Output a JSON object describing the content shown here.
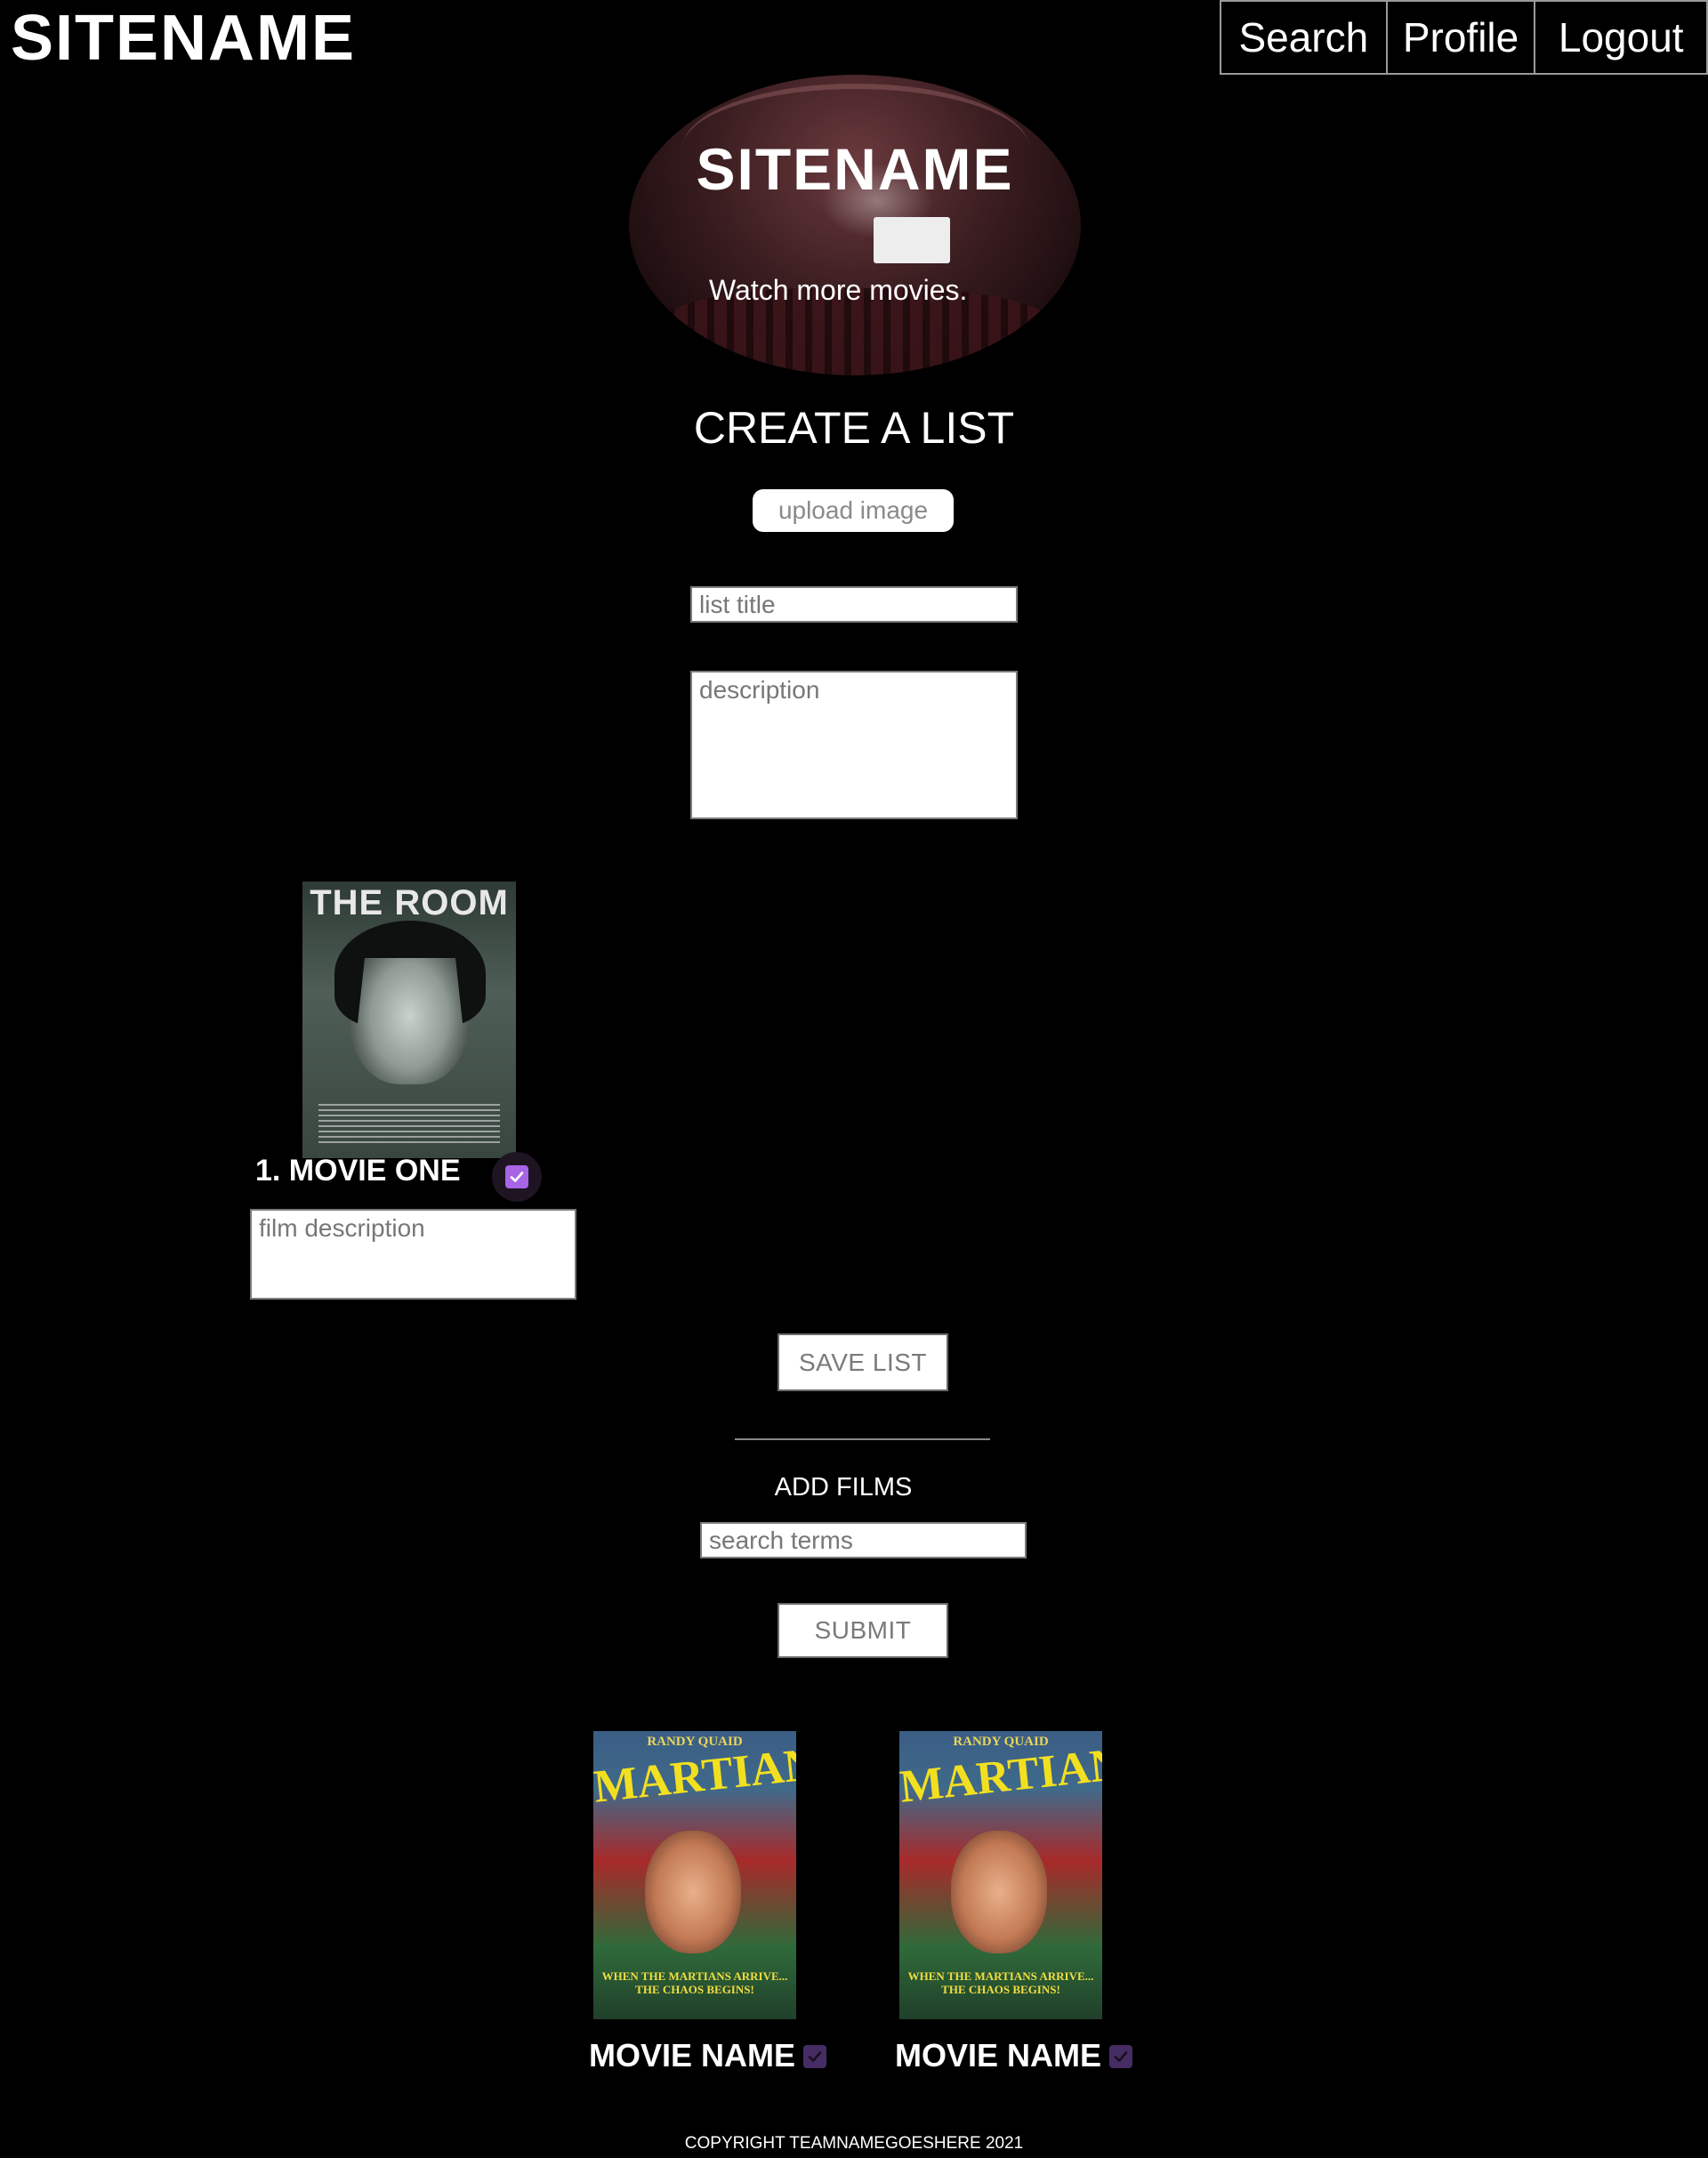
{
  "header": {
    "logo": "SITENAME",
    "nav": {
      "search": "Search",
      "profile": "Profile",
      "logout": "Logout"
    }
  },
  "hero": {
    "title": "SITENAME",
    "tagline": "Watch more movies."
  },
  "form": {
    "heading": "CREATE A LIST",
    "upload_label": "upload image",
    "list_title_placeholder": "list title",
    "description_placeholder": "description"
  },
  "list_entries": [
    {
      "poster_title": "THE ROOM",
      "label": "1. MOVIE ONE",
      "checked": true,
      "film_description_placeholder": "film description"
    }
  ],
  "save_button": "SAVE LIST",
  "add_films": {
    "heading": "ADD FILMS",
    "search_placeholder": "search terms",
    "submit_label": "SUBMIT"
  },
  "results": [
    {
      "poster_top": "RANDY QUAID",
      "poster_title": "MARTIANS",
      "poster_tag": "WHEN THE MARTIANS ARRIVE... THE CHAOS BEGINS!",
      "name": "MOVIE NAME",
      "checked": true
    },
    {
      "poster_top": "RANDY QUAID",
      "poster_title": "MARTIANS",
      "poster_tag": "WHEN THE MARTIANS ARRIVE... THE CHAOS BEGINS!",
      "name": "MOVIE NAME",
      "checked": true
    }
  ],
  "footer": {
    "copyright": "COPYRIGHT TEAMNAMEGOESHERE 2021"
  },
  "colors": {
    "background": "#000000",
    "checkbox_accent": "#a765e6",
    "checkbox_dim": "#452c63"
  },
  "icons": {
    "checkbox": "check-icon"
  }
}
